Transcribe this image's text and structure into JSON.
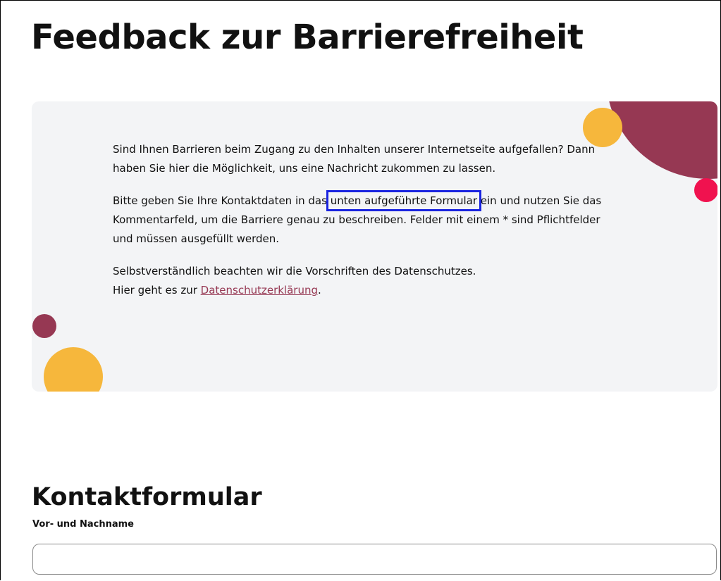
{
  "page": {
    "title": "Feedback zur Barrierefreiheit"
  },
  "intro": {
    "paragraph1": "Sind Ihnen Barrieren beim Zugang zu den Inhalten unserer Internetseite aufgefallen? Dann haben Sie hier die Möglichkeit, uns eine Nachricht zukommen zu lassen.",
    "paragraph2_before": "Bitte geben Sie Ihre Kontaktdaten in das ",
    "paragraph2_highlight": "unten aufgeführte Formular",
    "paragraph2_after": " ein und nutzen Sie das Kommentarfeld, um die Barriere genau zu beschreiben. Felder mit einem * sind Pflichtfelder und müssen ausgefüllt werden.",
    "paragraph3_line1": "Selbstverständlich beachten wir die Vorschriften des Datenschutzes.",
    "paragraph3_prefix": "Hier geht es zur ",
    "privacy_link": "Datenschutzerklärung",
    "paragraph3_suffix": "."
  },
  "form": {
    "title": "Kontaktformular",
    "name_label": "Vor- und Nachname",
    "name_value": "",
    "name_placeholder": ""
  },
  "colors": {
    "maroon": "#963853",
    "yellow": "#f6b73c",
    "pink": "#f0124f",
    "box_background": "#f3f4f6",
    "highlight_border": "#1a24e0"
  }
}
